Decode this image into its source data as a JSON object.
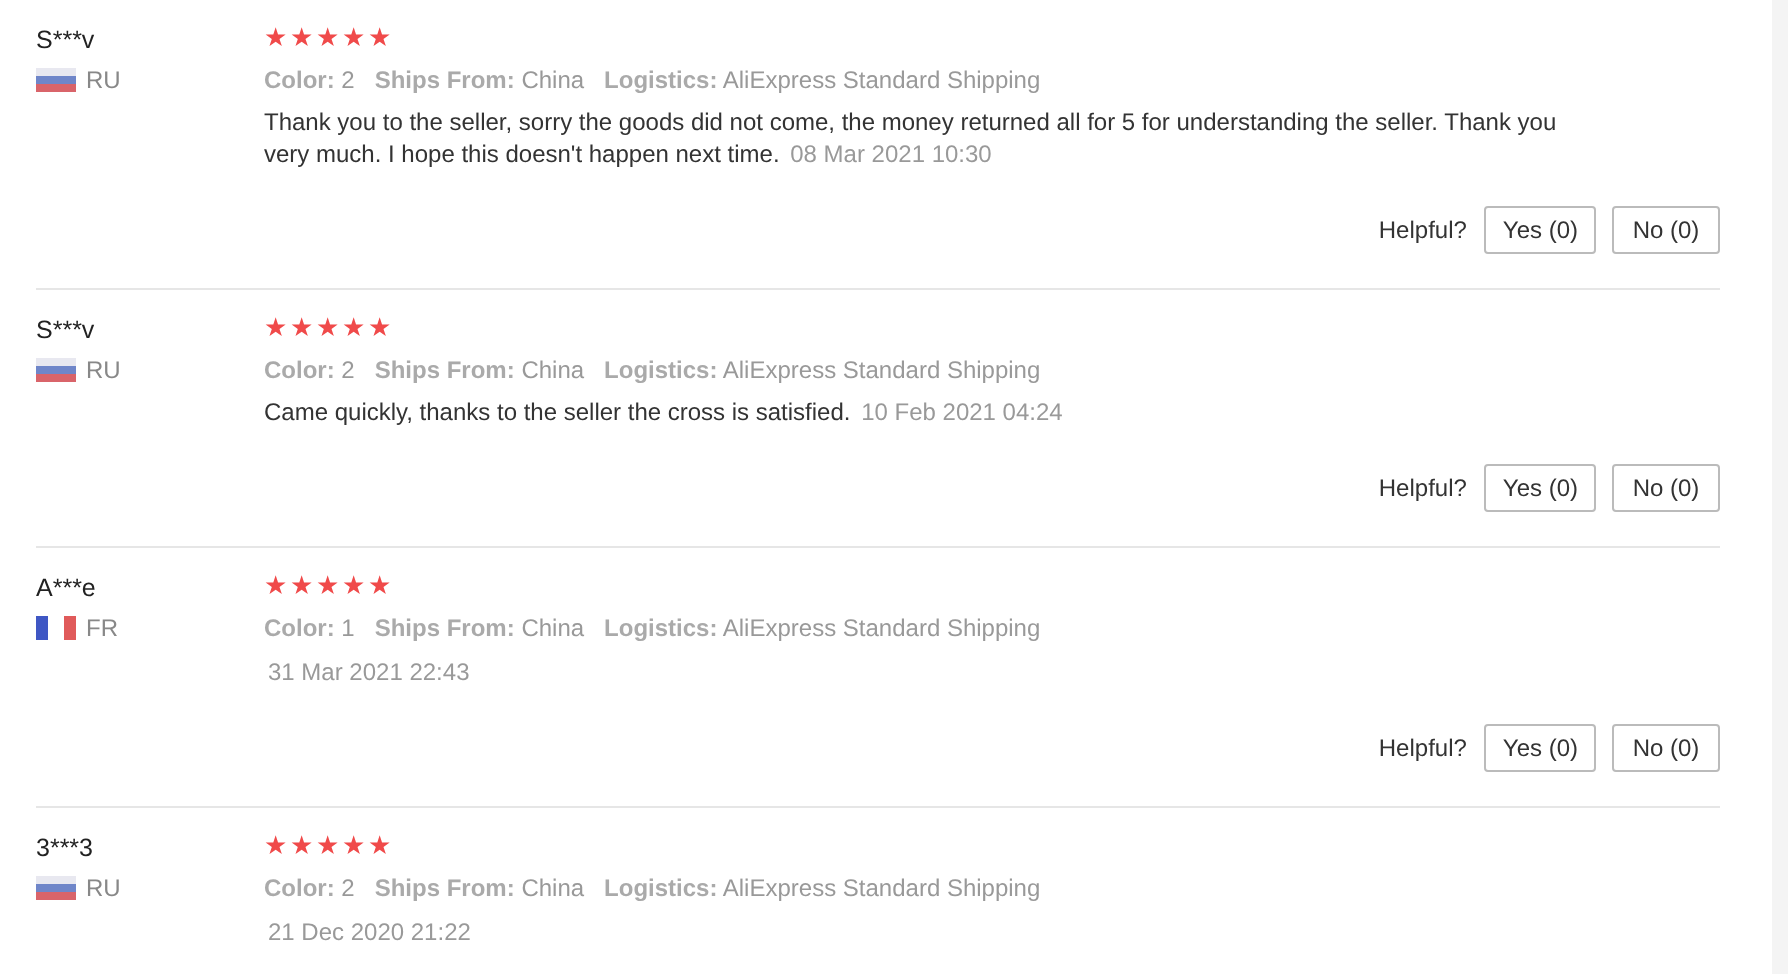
{
  "reviews": [
    {
      "user": "S***v",
      "kind": "ru",
      "country": "RU",
      "stars": 5,
      "meta": [
        {
          "label": "Color:",
          "value": "2"
        },
        {
          "label": "Ships From:",
          "value": "China"
        },
        {
          "label": "Logistics:",
          "value": "AliExpress Standard Shipping"
        }
      ],
      "text": "Thank you to the seller, sorry the goods did not come, the money returned all for 5 for understanding the seller. Thank you very much. I hope this doesn't happen next time.",
      "date": "08 Mar 2021 10:30",
      "helpful_label": "Helpful?",
      "yes": "Yes (0)",
      "no": "No (0)"
    },
    {
      "user": "S***v",
      "kind": "ru",
      "country": "RU",
      "stars": 5,
      "meta": [
        {
          "label": "Color:",
          "value": "2"
        },
        {
          "label": "Ships From:",
          "value": "China"
        },
        {
          "label": "Logistics:",
          "value": "AliExpress Standard Shipping"
        }
      ],
      "text": "Came quickly, thanks to the seller the cross is satisfied.",
      "date": "10 Feb 2021 04:24",
      "helpful_label": "Helpful?",
      "yes": "Yes (0)",
      "no": "No (0)"
    },
    {
      "user": "A***e",
      "kind": "fr",
      "country": "FR",
      "stars": 5,
      "meta": [
        {
          "label": "Color:",
          "value": "1"
        },
        {
          "label": "Ships From:",
          "value": "China"
        },
        {
          "label": "Logistics:",
          "value": "AliExpress Standard Shipping"
        }
      ],
      "date": "31 Mar 2021 22:43",
      "helpful_label": "Helpful?",
      "yes": "Yes (0)",
      "no": "No (0)"
    },
    {
      "user": "3***3",
      "kind": "ru",
      "country": "RU",
      "stars": 5,
      "meta": [
        {
          "label": "Color:",
          "value": "2"
        },
        {
          "label": "Ships From:",
          "value": "China"
        },
        {
          "label": "Logistics:",
          "value": "AliExpress Standard Shipping"
        }
      ],
      "date": "21 Dec 2020 21:22"
    }
  ]
}
